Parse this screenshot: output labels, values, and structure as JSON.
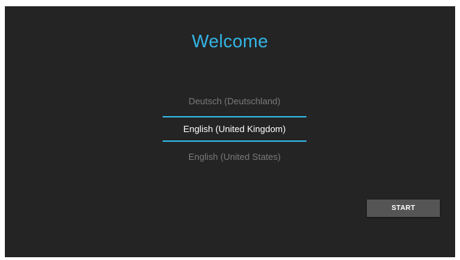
{
  "screen": {
    "title": "Welcome",
    "accent_color": "#33b5e5",
    "background_color": "#242424"
  },
  "languages": {
    "items": [
      {
        "label": "Deutsch (Deutschland)",
        "selected": false
      },
      {
        "label": "English (United Kingdom)",
        "selected": true
      },
      {
        "label": "English (United States)",
        "selected": false
      }
    ]
  },
  "actions": {
    "start_label": "START"
  }
}
